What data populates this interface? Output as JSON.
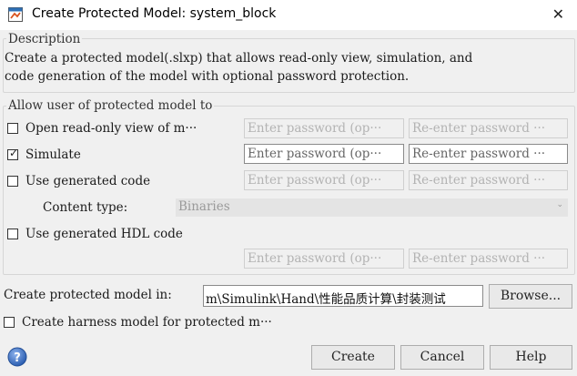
{
  "window": {
    "title": "Create Protected Model: system_block",
    "close_glyph": "✕"
  },
  "description": {
    "legend": "Description",
    "line1": "Create a protected model(.slxp) that allows read-only view, simulation, and",
    "line2": "code generation of the model with optional password protection."
  },
  "permissions": {
    "legend": "Allow user of protected model to",
    "read_only": {
      "label": "Open read-only view of m···",
      "checked": false,
      "password_placeholder": "Enter password (op···",
      "reenter_placeholder": "Re-enter password ···"
    },
    "simulate": {
      "label": "Simulate",
      "checked": true,
      "check_glyph": "✓",
      "password_placeholder": "Enter password (op···",
      "reenter_placeholder": "Re-enter password ···"
    },
    "generated_code": {
      "label": "Use generated code",
      "checked": false,
      "password_placeholder": "Enter password (op···",
      "reenter_placeholder": "Re-enter password ···"
    },
    "content_type": {
      "label": "Content type:",
      "value": "Binaries",
      "chevron": "⌄"
    },
    "hdl_code": {
      "label": "Use generated HDL code",
      "checked": false,
      "password_placeholder": "Enter password (op···",
      "reenter_placeholder": "Re-enter password ···"
    }
  },
  "output": {
    "label": "Create protected model in:",
    "path": "m\\Simulink\\Hand\\性能品质计算\\封装测试",
    "browse_label": "Browse..."
  },
  "harness": {
    "label": "Create harness model for protected m···",
    "checked": false
  },
  "footer": {
    "help_icon_glyph": "?",
    "create_label": "Create",
    "cancel_label": "Cancel",
    "help_label": "Help"
  },
  "colors": {
    "dialog_bg": "#f0f0f0",
    "help_icon": "#3d6fc4"
  }
}
